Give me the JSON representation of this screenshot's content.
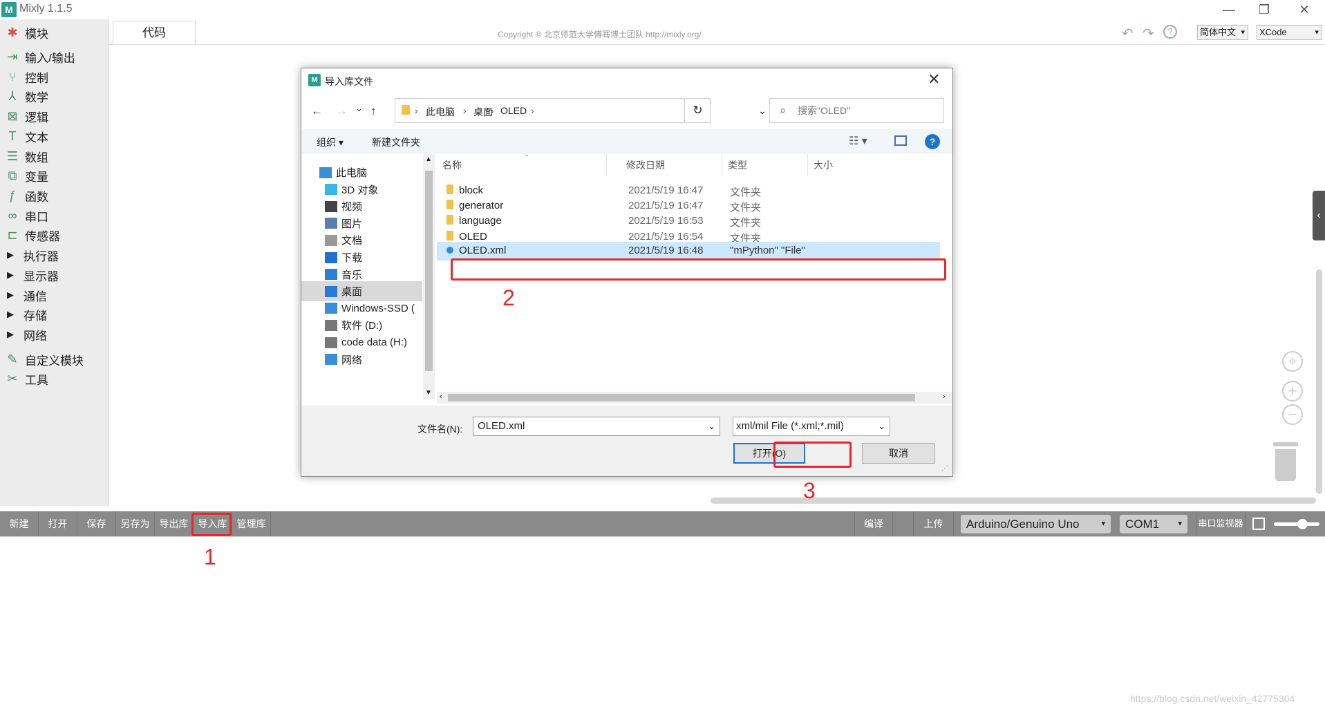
{
  "app": {
    "title": "Mixly 1.1.5",
    "logo_text": "M"
  },
  "window_controls": {
    "minimize": "—",
    "restore": "❐",
    "close": "✕"
  },
  "sidebar": {
    "items": [
      {
        "label": "模块",
        "icon": "puzzle-icon",
        "glyph": "✱",
        "expandable": false
      },
      {
        "label": "输入/输出",
        "icon": "io-icon",
        "glyph": "⇥",
        "expandable": false
      },
      {
        "label": "控制",
        "icon": "control-icon",
        "glyph": "⑂",
        "expandable": false
      },
      {
        "label": "数学",
        "icon": "math-icon",
        "glyph": "⅄",
        "expandable": false
      },
      {
        "label": "逻辑",
        "icon": "logic-icon",
        "glyph": "⊠",
        "expandable": false
      },
      {
        "label": "文本",
        "icon": "text-icon",
        "glyph": "T",
        "expandable": false
      },
      {
        "label": "数组",
        "icon": "array-icon",
        "glyph": "☰",
        "expandable": false
      },
      {
        "label": "变量",
        "icon": "variable-icon",
        "glyph": "⧉",
        "expandable": false
      },
      {
        "label": "函数",
        "icon": "function-icon",
        "glyph": "ƒ",
        "expandable": false
      },
      {
        "label": "串口",
        "icon": "serial-icon",
        "glyph": "∞",
        "expandable": false
      },
      {
        "label": "传感器",
        "icon": "sensor-icon",
        "glyph": "⊏",
        "expandable": false
      },
      {
        "label": "执行器",
        "icon": "",
        "glyph": "",
        "expandable": true
      },
      {
        "label": "显示器",
        "icon": "",
        "glyph": "",
        "expandable": true
      },
      {
        "label": "通信",
        "icon": "",
        "glyph": "",
        "expandable": true
      },
      {
        "label": "存储",
        "icon": "",
        "glyph": "",
        "expandable": true
      },
      {
        "label": "网络",
        "icon": "",
        "glyph": "",
        "expandable": true
      },
      {
        "label": "自定义模块",
        "icon": "custom-module-icon",
        "glyph": "✎",
        "expandable": false
      },
      {
        "label": "工具",
        "icon": "tools-icon",
        "glyph": "✂",
        "expandable": false
      }
    ]
  },
  "header": {
    "code_tab": "代码",
    "copyright": "Copyright © 北京师范大学傅骞博士团队 http://mixly.org/",
    "undo": "↶",
    "redo": "↷",
    "help": "?",
    "language": "简体中文",
    "theme": "XCode"
  },
  "workspace": {
    "flyout_arrow": "‹",
    "target": "⌖",
    "zoom_in": "+",
    "zoom_out": "−"
  },
  "toolbar": {
    "buttons": [
      "新建",
      "打开",
      "保存",
      "另存为",
      "导出库",
      "导入库",
      "管理库"
    ],
    "compile": "编译",
    "upload": "上传",
    "board": "Arduino/Genuino Uno",
    "port": "COM1",
    "serial_monitor": "串口监视器"
  },
  "watermark": "https://blog.csdn.net/weixin_42775304",
  "dialog": {
    "title": "导入库文件",
    "close": "✕",
    "nav": {
      "back": "←",
      "forward": "→",
      "recent": "⌄",
      "up": "↑"
    },
    "breadcrumb": [
      "此电脑",
      "桌面",
      "OLED"
    ],
    "refresh": "↻",
    "search_placeholder": "搜索\"OLED\"",
    "search_icon": "⌕",
    "organize": "组织 ▾",
    "new_folder": "新建文件夹",
    "help": "?",
    "nav_pane": [
      {
        "label": "此电脑",
        "icon": "pc-icon",
        "color": "#3a8ed8"
      },
      {
        "label": "3D 对象",
        "icon": "3d-objects-icon",
        "color": "#38b6e8"
      },
      {
        "label": "视频",
        "icon": "video-icon",
        "color": "#444"
      },
      {
        "label": "图片",
        "icon": "picture-icon",
        "color": "#5a7fae"
      },
      {
        "label": "文档",
        "icon": "document-icon",
        "color": "#999"
      },
      {
        "label": "下载",
        "icon": "download-icon",
        "color": "#1f6fd1"
      },
      {
        "label": "音乐",
        "icon": "music-icon",
        "color": "#2f7ed8"
      },
      {
        "label": "桌面",
        "icon": "desktop-icon",
        "color": "#2979d6"
      },
      {
        "label": "Windows-SSD (",
        "icon": "windows-drive-icon",
        "color": "#3a8ed8"
      },
      {
        "label": "软件 (D:)",
        "icon": "drive-icon",
        "color": "#777"
      },
      {
        "label": "code data (H:)",
        "icon": "drive-icon",
        "color": "#777"
      },
      {
        "label": "网络",
        "icon": "network-icon",
        "color": "#3a8ed8"
      }
    ],
    "columns": {
      "name": "名称",
      "modified": "修改日期",
      "type": "类型",
      "size": "大小"
    },
    "files": [
      {
        "name": "block",
        "modified": "2021/5/19 16:47",
        "type": "文件夹"
      },
      {
        "name": "generator",
        "modified": "2021/5/19 16:47",
        "type": "文件夹"
      },
      {
        "name": "language",
        "modified": "2021/5/19 16:53",
        "type": "文件夹"
      },
      {
        "name": "OLED",
        "modified": "2021/5/19 16:54",
        "type": "文件夹"
      },
      {
        "name": "OLED.xml",
        "modified": "2021/5/19 16:48",
        "type": "\"mPython\" \"File\""
      }
    ],
    "filename_label": "文件名(N):",
    "filename_value": "OLED.xml",
    "filter": "xml/mil File (*.xml;*.mil)",
    "open": "打开(O)",
    "cancel": "取消"
  },
  "annotations": {
    "step1": "1",
    "step2": "2",
    "step3": "3",
    "color": "#e8262b"
  }
}
